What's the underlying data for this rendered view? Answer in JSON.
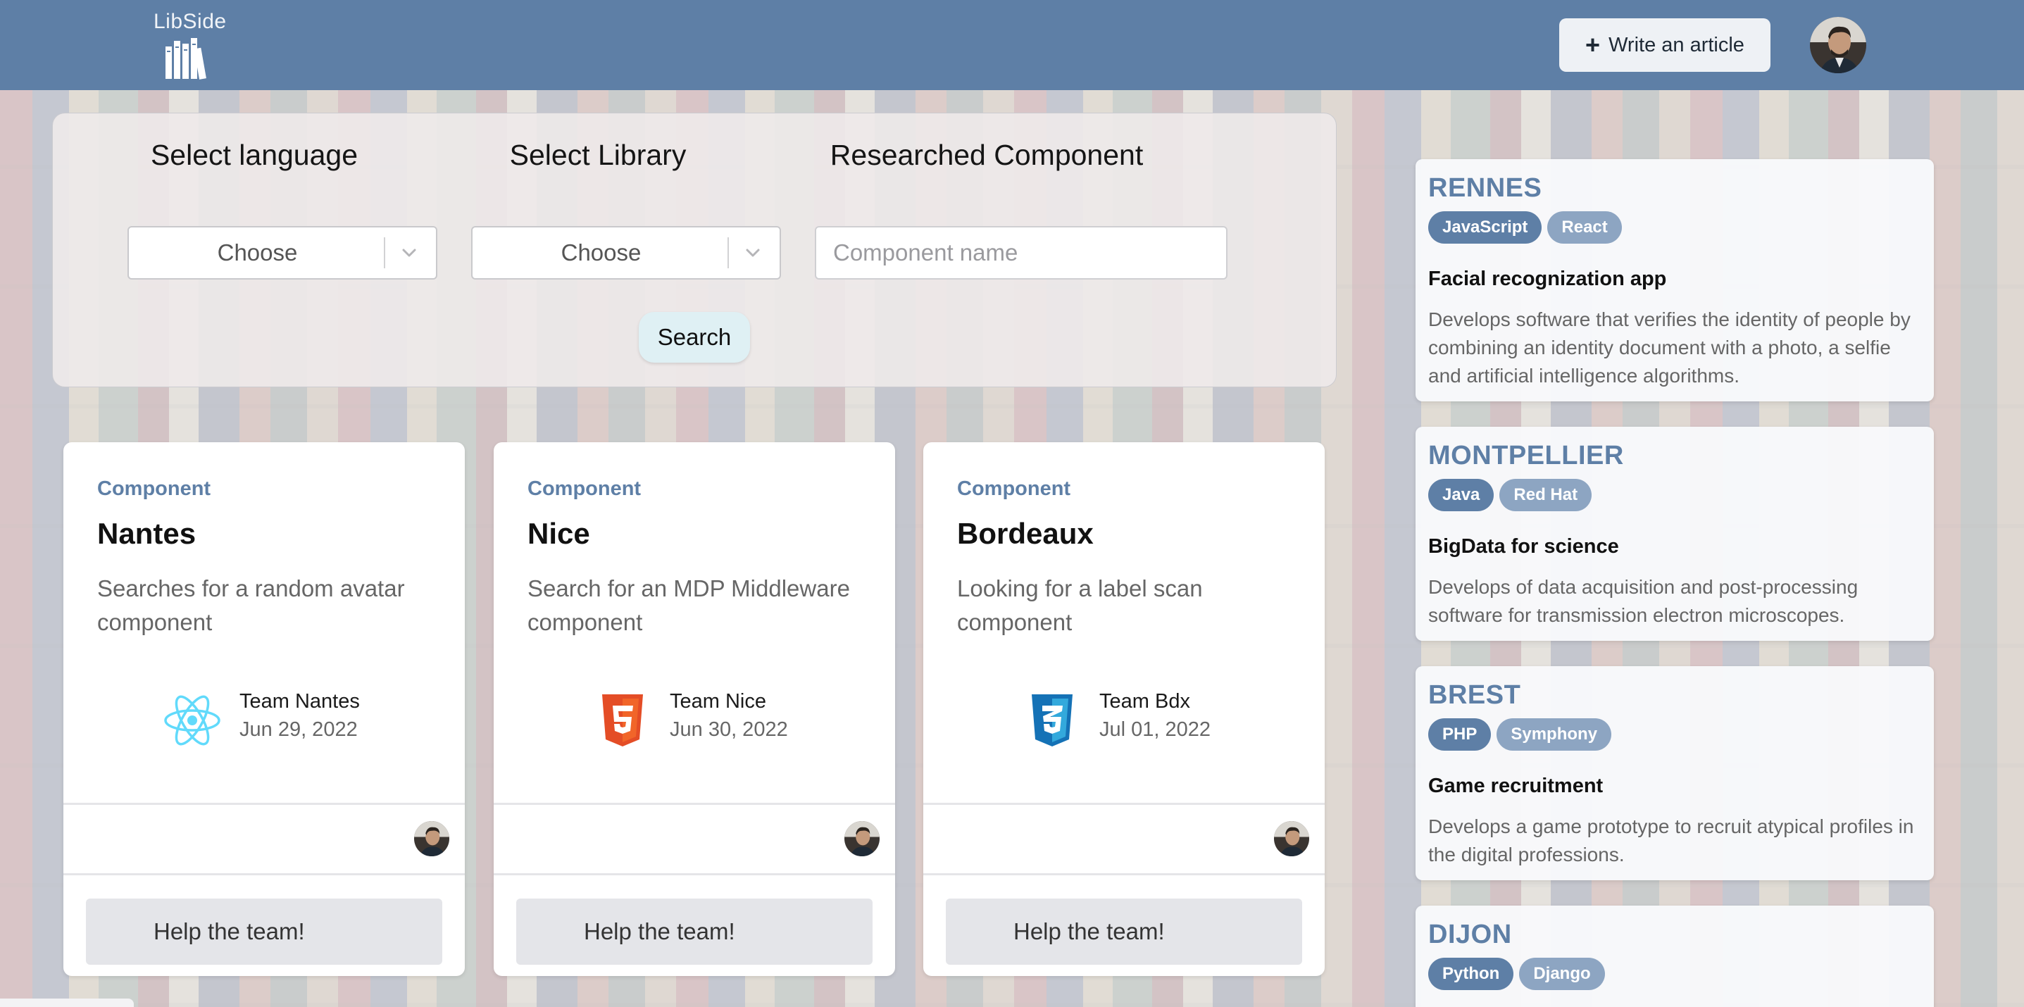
{
  "header": {
    "logo_text": "LibSide",
    "write_button_label": "Write an article",
    "write_button_icon": "plus-icon"
  },
  "search": {
    "language_label": "Select language",
    "library_label": "Select Library",
    "component_label": "Researched Component",
    "language_value": "Choose",
    "library_value": "Choose",
    "component_placeholder": "Component name",
    "search_button_label": "Search"
  },
  "cards": [
    {
      "kicker": "Component",
      "title": "Nantes",
      "description": "Searches for a random avatar component",
      "team_icon": "react-icon",
      "team_name": "Team Nantes",
      "date": "Jun 29, 2022",
      "help_label": "Help the team!"
    },
    {
      "kicker": "Component",
      "title": "Nice",
      "description": "Search for an MDP Middleware component",
      "team_icon": "html5-icon",
      "team_name": "Team Nice",
      "date": "Jun 30, 2022",
      "help_label": "Help the team!"
    },
    {
      "kicker": "Component",
      "title": "Bordeaux",
      "description": "Looking for a label scan component",
      "team_icon": "css3-icon",
      "team_name": "Team Bdx",
      "date": "Jul 01, 2022",
      "help_label": "Help the team!"
    }
  ],
  "articles": [
    {
      "city": "RENNES",
      "tags": [
        "JavaScript",
        "React"
      ],
      "title": "Facial recognization app",
      "description": "Develops software that verifies the identity of people by combining an identity document with a photo, a selfie and artificial intelligence algorithms."
    },
    {
      "city": "MONTPELLIER",
      "tags": [
        "Java",
        "Red Hat"
      ],
      "title": "BigData for science",
      "description": "Develops of data acquisition and post-processing software for transmission electron microscopes."
    },
    {
      "city": "BREST",
      "tags": [
        "PHP",
        "Symphony"
      ],
      "title": "Game recruitment",
      "description": "Develops a game prototype to recruit atypical profiles in the digital professions."
    },
    {
      "city": "DIJON",
      "tags": [
        "Python",
        "Django"
      ]
    }
  ],
  "colors": {
    "header_bg": "#5e7fa6",
    "accent": "#5e7fa6",
    "tag_dark": "#5e7fa6",
    "tag_light": "#8da5c2",
    "react": "#61dafb",
    "html5": "#e44d26",
    "css3": "#1572b6"
  }
}
